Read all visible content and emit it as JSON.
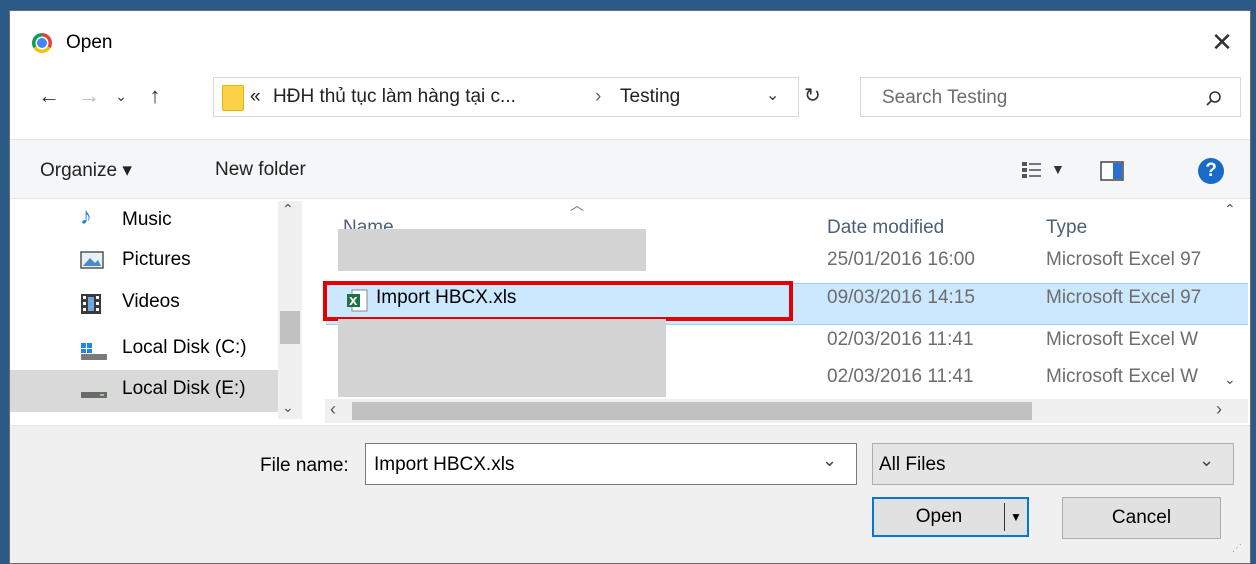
{
  "window": {
    "title": "Open"
  },
  "address": {
    "overflow": "«",
    "crumb1": "HĐH thủ tục làm hàng tại c...",
    "separator": "›",
    "crumb2": "Testing"
  },
  "search": {
    "placeholder": "Search Testing"
  },
  "toolbar": {
    "organize": "Organize ▾",
    "new_folder": "New folder",
    "help": "?"
  },
  "sidebar": {
    "items": [
      {
        "label": "Music"
      },
      {
        "label": "Pictures"
      },
      {
        "label": "Videos"
      },
      {
        "label": "Local Disk (C:)"
      },
      {
        "label": "Local Disk (E:)"
      }
    ]
  },
  "columns": {
    "name": "Name",
    "date": "Date modified",
    "type": "Type"
  },
  "files": [
    {
      "name": "",
      "date": "25/01/2016 16:00",
      "type": "Microsoft Excel 97"
    },
    {
      "name": "Import HBCX.xls",
      "date": "09/03/2016 14:15",
      "type": "Microsoft Excel 97"
    },
    {
      "name": "",
      "date": "02/03/2016 11:41",
      "type": "Microsoft Excel W"
    },
    {
      "name": "",
      "date": "02/03/2016 11:41",
      "type": "Microsoft Excel W"
    }
  ],
  "bottom": {
    "filename_label": "File name:",
    "filename_value": "Import HBCX.xls",
    "filter_value": "All Files",
    "open_label": "Open",
    "cancel_label": "Cancel"
  },
  "colors": {
    "selection": "#cce8ff",
    "highlight_box": "#e30000",
    "help": "#1a6ac7"
  }
}
